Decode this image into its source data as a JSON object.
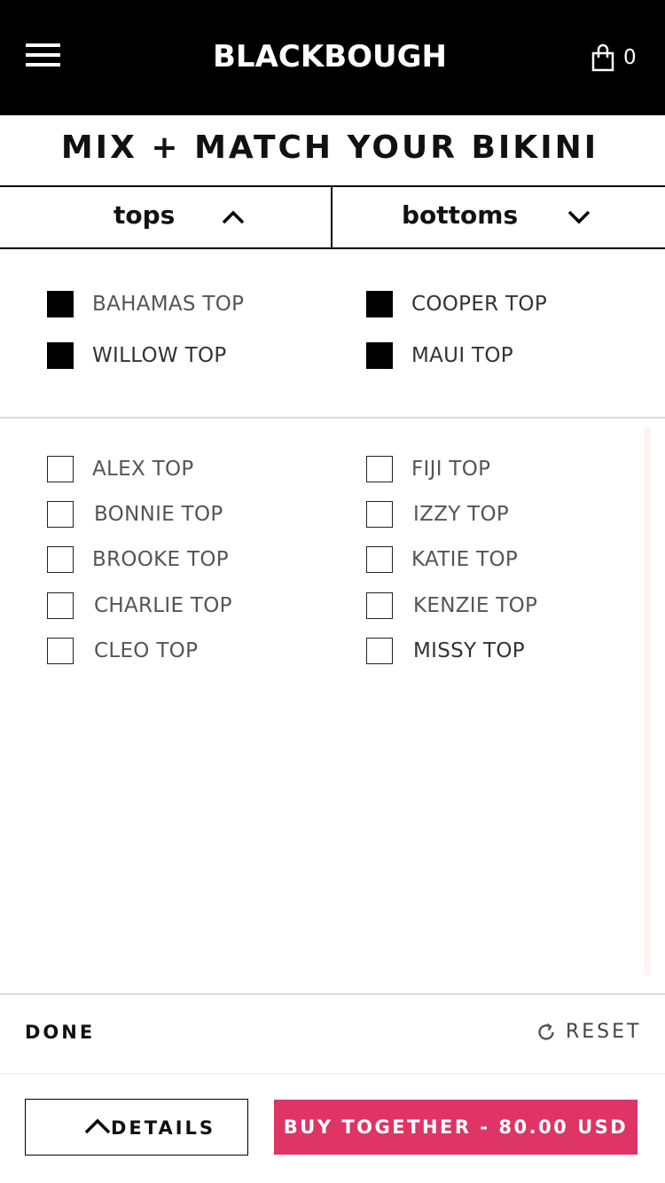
{
  "header": {
    "logo": "BLACKBOUGH",
    "cart_count": "0",
    "menu_icon": "hamburger-menu-icon",
    "cart_icon": "shopping-bag-icon"
  },
  "title": "MIX + MATCH YOUR BIKINI",
  "tabs": {
    "tops": "tops",
    "bottoms": "bottoms"
  },
  "selected_items": [
    {
      "label": "BAHAMAS TOP",
      "checked": true
    },
    {
      "label": "COOPER TOP",
      "checked": true
    },
    {
      "label": "WILLOW TOP",
      "checked": true
    },
    {
      "label": "MAUI TOP",
      "checked": true
    }
  ],
  "list_items": [
    {
      "label": "ALEX TOP",
      "checked": false
    },
    {
      "label": "FIJI TOP",
      "checked": false
    },
    {
      "label": "BONNIE TOP",
      "checked": false
    },
    {
      "label": "IZZY TOP",
      "checked": false
    },
    {
      "label": "BROOKE TOP",
      "checked": false
    },
    {
      "label": "KATIE TOP",
      "checked": false
    },
    {
      "label": "CHARLIE TOP",
      "checked": false
    },
    {
      "label": "KENZIE TOP",
      "checked": false
    },
    {
      "label": "CLEO TOP",
      "checked": false
    },
    {
      "label": "MISSY TOP",
      "checked": false
    }
  ],
  "actions": {
    "done": "DONE",
    "reset": "RESET",
    "details": "DETAILS",
    "buy": "BUY TOGETHER - 80.00 USD"
  },
  "colors": {
    "accent": "#de3466",
    "header_bg": "#000000"
  }
}
